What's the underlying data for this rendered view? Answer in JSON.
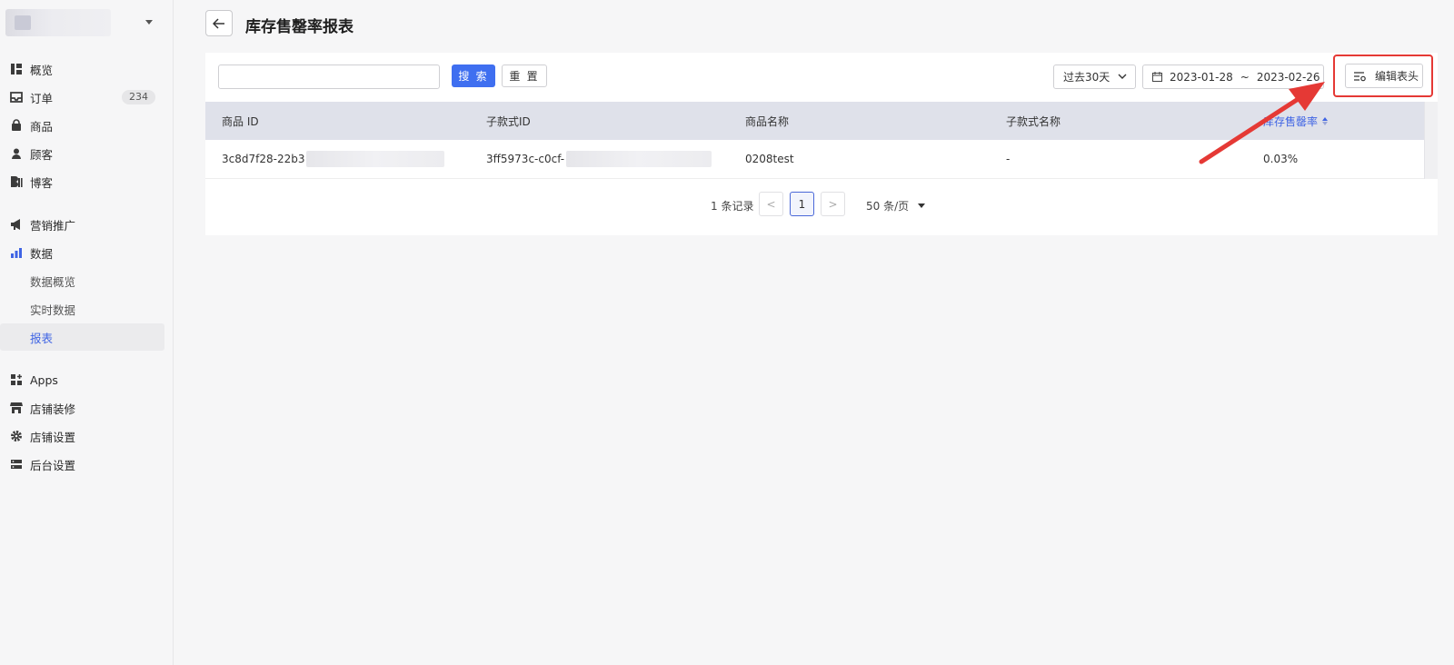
{
  "sidebar": {
    "badges": {
      "orders": "234"
    },
    "items": [
      {
        "label": "概览",
        "icon": "overview-icon"
      },
      {
        "label": "订单",
        "icon": "inbox-icon"
      },
      {
        "label": "商品",
        "icon": "bag-icon"
      },
      {
        "label": "顾客",
        "icon": "user-icon"
      },
      {
        "label": "博客",
        "icon": "blog-icon"
      },
      {
        "label": "营销推广",
        "icon": "megaphone-icon"
      },
      {
        "label": "数据",
        "icon": "bar-chart-icon"
      },
      {
        "label": "Apps",
        "icon": "apps-icon"
      },
      {
        "label": "店铺装修",
        "icon": "storefront-icon"
      },
      {
        "label": "店铺设置",
        "icon": "gear-icon"
      },
      {
        "label": "后台设置",
        "icon": "server-icon"
      }
    ],
    "sub_items": [
      {
        "label": "数据概览"
      },
      {
        "label": "实时数据"
      },
      {
        "label": "报表"
      }
    ],
    "active_sub_item": "报表"
  },
  "header": {
    "title": "库存售罄率报表"
  },
  "toolbar": {
    "search_value": "",
    "search_label": "搜 索",
    "reset_label": "重 置",
    "range_label": "过去30天",
    "date_start": "2023-01-28",
    "date_sep": "~",
    "date_end": "2023-02-26",
    "edit_header_label": "编辑表头"
  },
  "table": {
    "columns": [
      "商品 ID",
      "子款式ID",
      "商品名称",
      "子款式名称",
      "库存售罄率"
    ],
    "rows": [
      [
        "3c8d7f28-22b3",
        "3ff5973c-c0cf-",
        "0208test",
        "-",
        "0.03%"
      ]
    ]
  },
  "pagination": {
    "total": "1 条记录",
    "prev": "<",
    "current": "1",
    "next": ">",
    "page_size": "50 条/页"
  },
  "colors": {
    "accent": "#3f6ff0",
    "annotation": "#e53935",
    "header_bg": "#dfe1ea"
  }
}
